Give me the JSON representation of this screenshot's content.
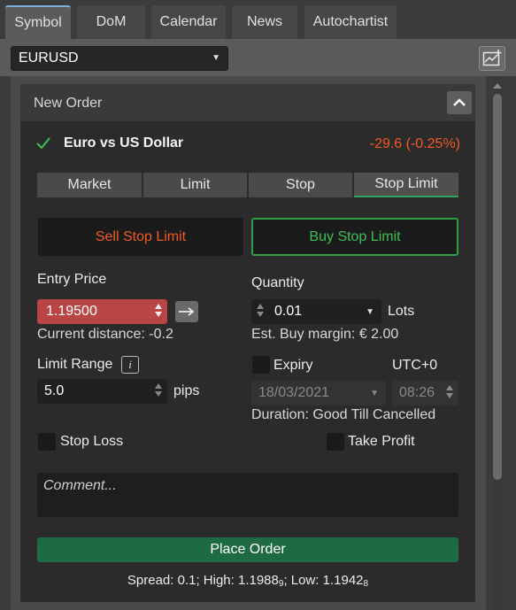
{
  "tabs": [
    {
      "label": "Symbol",
      "active": true
    },
    {
      "label": "DoM",
      "active": false
    },
    {
      "label": "Calendar",
      "active": false
    },
    {
      "label": "News",
      "active": false
    },
    {
      "label": "Autochartist",
      "active": false
    }
  ],
  "symbol_select": {
    "value": "EURUSD"
  },
  "panel": {
    "title": "New Order"
  },
  "symbol": {
    "name": "Euro vs US Dollar",
    "change": "-29.6 (-0.25%)"
  },
  "order_types": [
    {
      "label": "Market",
      "active": false
    },
    {
      "label": "Limit",
      "active": false
    },
    {
      "label": "Stop",
      "active": false
    },
    {
      "label": "Stop Limit",
      "active": true
    }
  ],
  "side": {
    "sell_label": "Sell Stop Limit",
    "buy_label": "Buy Stop Limit",
    "selected": "buy"
  },
  "entry": {
    "label": "Entry Price",
    "value": "1.19500",
    "distance": "Current distance: -0.2"
  },
  "quantity": {
    "label": "Quantity",
    "value": "0.01",
    "unit": "Lots",
    "margin": "Est. Buy margin: € 2.00"
  },
  "limit_range": {
    "label": "Limit Range",
    "info": "i",
    "value": "5.0",
    "unit": "pips"
  },
  "expiry": {
    "label": "Expiry",
    "checked": false,
    "timezone": "UTC+0",
    "date": "18/03/2021",
    "time": "08:26",
    "duration": "Duration: Good Till Cancelled"
  },
  "stop_loss": {
    "label": "Stop Loss",
    "checked": false
  },
  "take_profit": {
    "label": "Take Profit",
    "checked": false
  },
  "comment": {
    "placeholder": "Comment..."
  },
  "place_order": {
    "label": "Place Order"
  },
  "footer": {
    "spread_text": "Spread: 0.1; High: 1.1988",
    "high_pip": "9",
    "low_text": "; Low: 1.1942",
    "low_pip": "8"
  },
  "colors": {
    "negative": "#f05a23",
    "positive": "#3cbf55",
    "place_order_bg": "#1e6b43",
    "entry_bg": "#b94545"
  }
}
